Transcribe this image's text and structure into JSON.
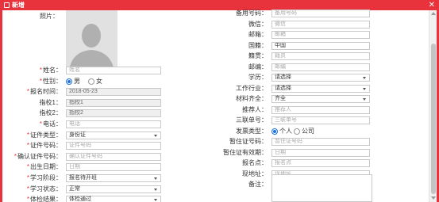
{
  "dialog": {
    "title": "新增",
    "close_glyph": "✕"
  },
  "photo_label": "照片：",
  "left_fields": [
    {
      "key": "name",
      "label": "姓名：",
      "required": true,
      "type": "input",
      "placeholder": "姓名",
      "value": ""
    },
    {
      "key": "gender",
      "label": "性别：",
      "required": true,
      "type": "radio",
      "options": [
        "男",
        "女"
      ],
      "selected": "男"
    },
    {
      "key": "reg_time",
      "label": "报名时间：",
      "required": true,
      "type": "input",
      "value": "2018-05-23",
      "disabled": true
    },
    {
      "key": "campus1",
      "label": "指校1：",
      "required": false,
      "type": "input",
      "value": "指校1",
      "disabled": true
    },
    {
      "key": "campus2",
      "label": "指校2：",
      "required": false,
      "type": "input",
      "value": "指校2",
      "disabled": true
    },
    {
      "key": "phone",
      "label": "电话：",
      "required": true,
      "type": "input",
      "placeholder": "电话",
      "value": ""
    },
    {
      "key": "id_type",
      "label": "证件类型：",
      "required": true,
      "type": "select",
      "value": "身份证"
    },
    {
      "key": "id_no",
      "label": "证件号码：",
      "required": true,
      "type": "input",
      "placeholder": "证件号码",
      "value": ""
    },
    {
      "key": "id_confirm",
      "label": "确认证件号码：",
      "required": true,
      "type": "input",
      "placeholder": "确认证件号码",
      "value": ""
    },
    {
      "key": "birth",
      "label": "出生日期：",
      "required": true,
      "type": "input",
      "placeholder": "日期",
      "value": ""
    },
    {
      "key": "stage",
      "label": "学习阶段：",
      "required": true,
      "type": "select",
      "value": "报名待开班"
    },
    {
      "key": "status",
      "label": "学习状态：",
      "required": true,
      "type": "select",
      "value": "正常"
    },
    {
      "key": "exam",
      "label": "体检结果：",
      "required": true,
      "type": "select",
      "value": "体检通过"
    }
  ],
  "right_fields": [
    {
      "key": "alt_phone",
      "label": "备用号码：",
      "type": "input",
      "placeholder": "备用号码",
      "value": ""
    },
    {
      "key": "wechat",
      "label": "微信：",
      "type": "input",
      "placeholder": "微信",
      "value": ""
    },
    {
      "key": "email",
      "label": "邮箱：",
      "type": "input",
      "placeholder": "邮箱",
      "value": ""
    },
    {
      "key": "nation",
      "label": "国籍：",
      "type": "input",
      "value": "中国"
    },
    {
      "key": "native",
      "label": "籍贯：",
      "type": "input",
      "placeholder": "籍贯",
      "value": ""
    },
    {
      "key": "postcode",
      "label": "邮编：",
      "type": "input",
      "placeholder": "邮编",
      "value": ""
    },
    {
      "key": "education",
      "label": "学历：",
      "type": "select",
      "value": "请选择"
    },
    {
      "key": "industry",
      "label": "工作行业：",
      "type": "select",
      "value": "请选择"
    },
    {
      "key": "material",
      "label": "材料齐全：",
      "type": "select",
      "value": "齐全"
    },
    {
      "key": "referrer",
      "label": "推荐人：",
      "type": "input",
      "placeholder": "推荐人",
      "value": ""
    },
    {
      "key": "triple",
      "label": "三联单号：",
      "type": "input",
      "placeholder": "三联单号",
      "value": ""
    },
    {
      "key": "invoice",
      "label": "发票类型：",
      "type": "radio",
      "options": [
        "个人",
        "公司"
      ],
      "selected": "个人"
    },
    {
      "key": "temp_id",
      "label": "暂住证号码：",
      "type": "input",
      "placeholder": "暂住证号码",
      "value": ""
    },
    {
      "key": "temp_exp",
      "label": "暂住证有效期：",
      "type": "input",
      "placeholder": "日期",
      "value": ""
    },
    {
      "key": "reg_point",
      "label": "报名点：",
      "type": "input",
      "placeholder": "报名点",
      "value": ""
    },
    {
      "key": "address",
      "label": "现地址：",
      "type": "input",
      "placeholder": "现地址",
      "value": ""
    },
    {
      "key": "remark",
      "label": "备注：",
      "type": "textarea",
      "value": ""
    }
  ],
  "colors": {
    "accent": "#e8323c",
    "radio": "#1e6fd9"
  }
}
